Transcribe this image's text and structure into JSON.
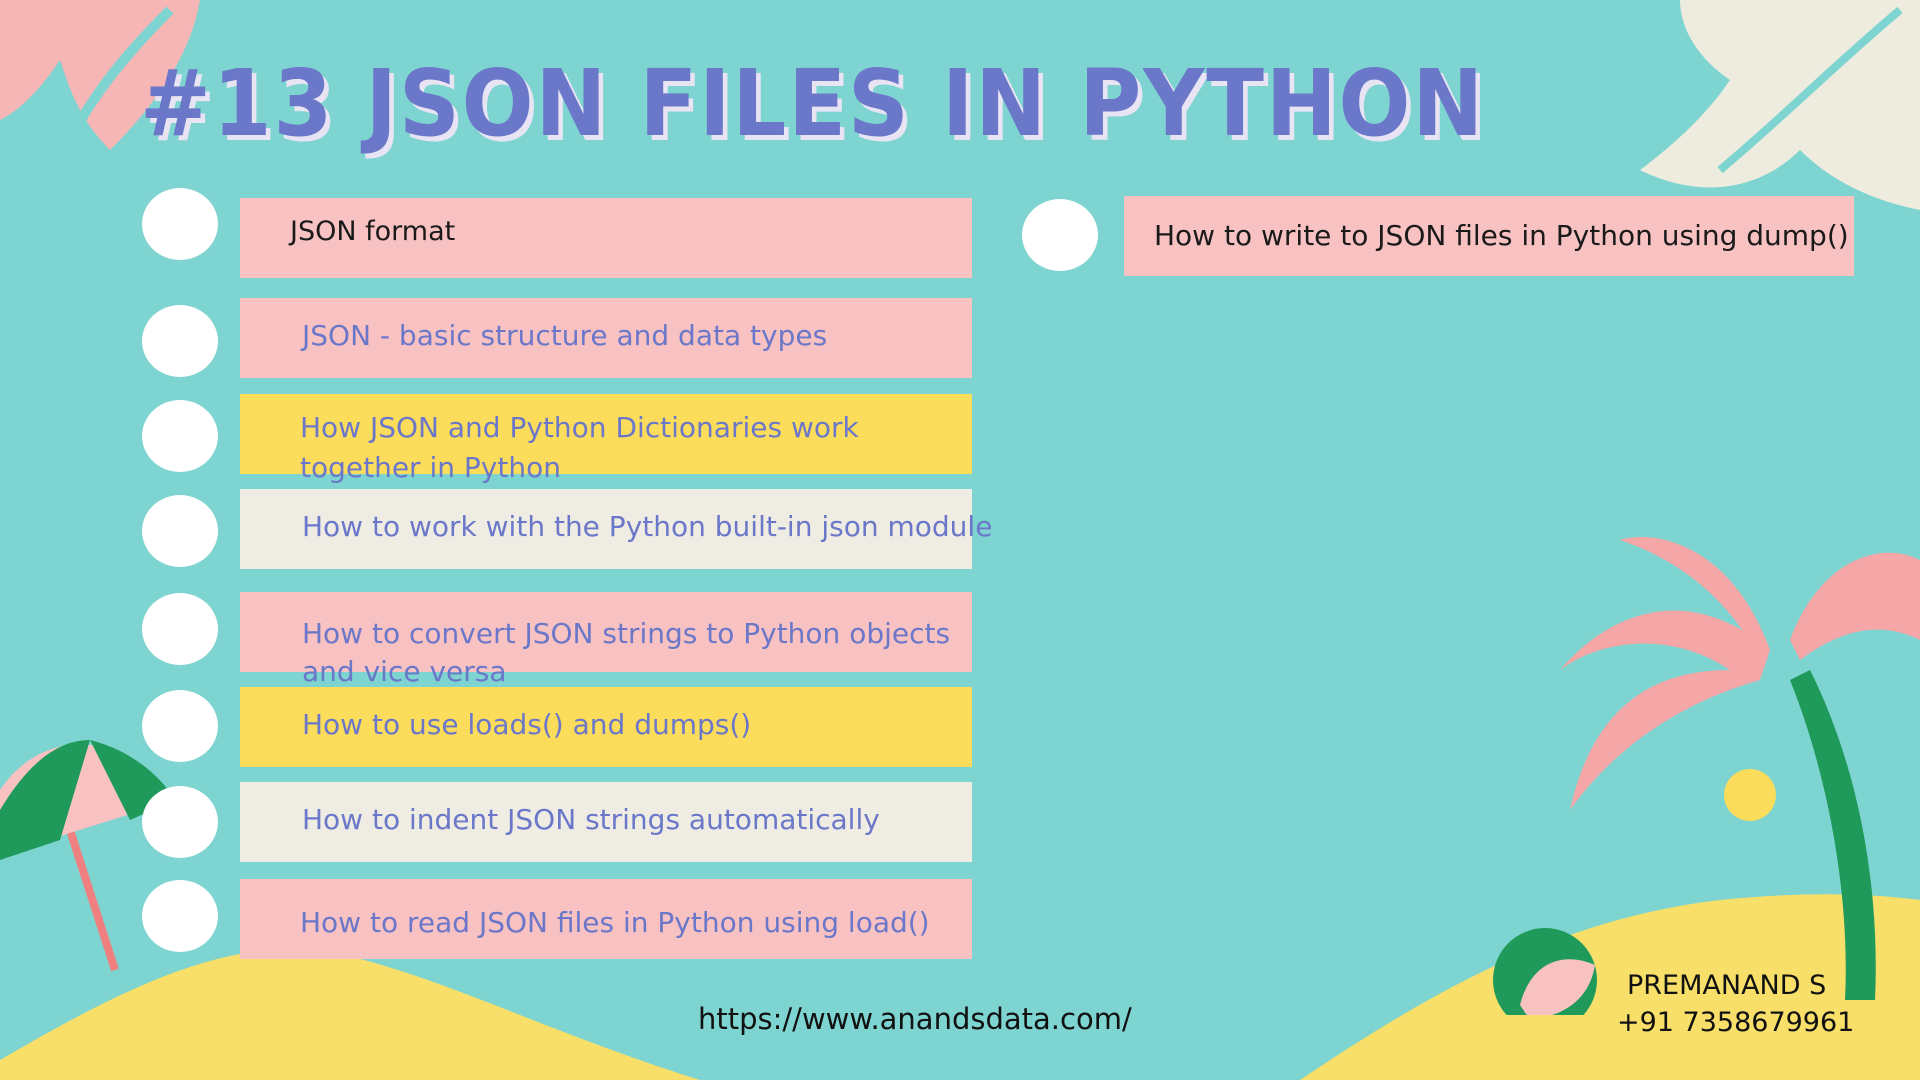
{
  "title": "#13 JSON FILES IN PYTHON",
  "topics_left": [
    {
      "label": "JSON format"
    },
    {
      "label": "JSON - basic structure and data types"
    },
    {
      "label": "How JSON and Python Dictionaries work",
      "label2": "together in Python"
    },
    {
      "label": "How to work with the Python built-in json module"
    },
    {
      "label": "How to convert JSON strings to Python objects",
      "label2": "and vice versa"
    },
    {
      "label": "How to use loads() and dumps()"
    },
    {
      "label": "How to indent JSON strings automatically"
    },
    {
      "label": "How to read JSON files in Python using load()"
    }
  ],
  "topics_right": [
    {
      "label": "How to write to JSON files in Python using dump()"
    }
  ],
  "footer": {
    "url": "https://www.anandsdata.com/",
    "author": "PREMANAND S",
    "phone": "+91 7358679961"
  },
  "colors": {
    "background": "#7dd4d1",
    "title": "#6b77c8",
    "pink": "#f9c2c2",
    "yellow": "#fcdc5b",
    "cream": "#efede3"
  }
}
